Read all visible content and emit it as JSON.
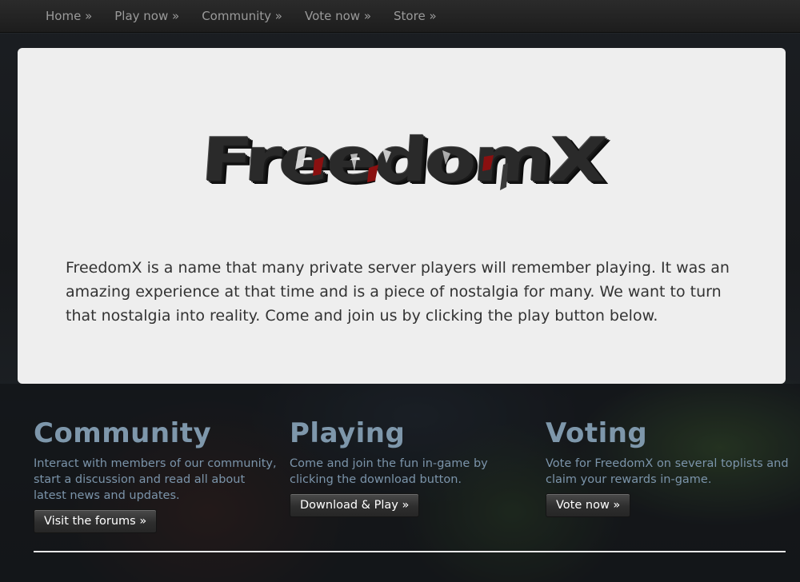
{
  "nav": {
    "items": [
      {
        "label": "Home »"
      },
      {
        "label": "Play now »"
      },
      {
        "label": "Community »"
      },
      {
        "label": "Vote now »"
      },
      {
        "label": "Store »"
      }
    ]
  },
  "hero": {
    "logo_text": "FreedomX",
    "description": "FreedomX is a name that many private server players will remember playing. It was an amazing experience at that time and is a piece of nostalgia for many. We want to turn that nostalgia into reality. Come and join us by clicking the play button below."
  },
  "columns": [
    {
      "title": "Community",
      "text": "Interact with members of our community, start a discussion and read all about latest news and updates.",
      "button": "Visit the forums »"
    },
    {
      "title": "Playing",
      "text": "Come and join the fun in-game by clicking the download button.",
      "button": "Download & Play »"
    },
    {
      "title": "Voting",
      "text": "Vote for FreedomX on several toplists and claim your rewards in-game.",
      "button": "Vote now »"
    }
  ],
  "colors": {
    "accent_title": "#7e97ab",
    "accent_text": "#7b94aa",
    "hero_bg": "#eeeeee",
    "logo_crack_red": "#8a1010"
  },
  "icons": {
    "logo": "freedomx-logo-3d"
  }
}
